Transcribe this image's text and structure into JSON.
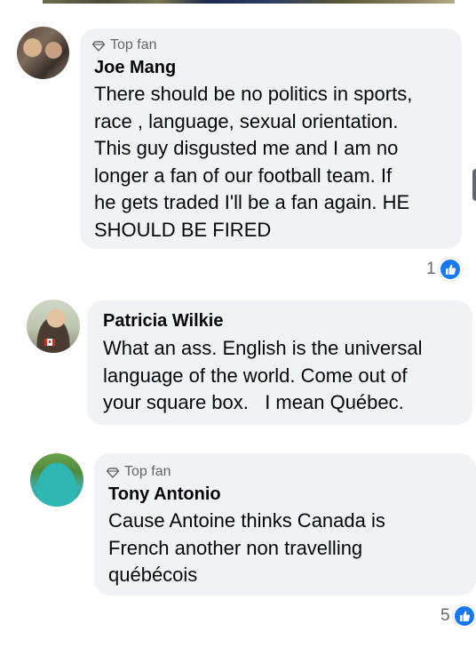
{
  "colors": {
    "bubble": "#f0f2f5",
    "text": "#050505",
    "secondary": "#65676b",
    "like": "#1877f2"
  },
  "comments": [
    {
      "badge": "Top fan",
      "badge_icon": "diamond-icon",
      "name": "Joe Mang",
      "lines": [
        "There should be no politics in sports,",
        "race , language, sexual orientation.",
        "This guy disgusted me and I am no",
        "longer a fan of our football team. If",
        "he gets traded I'll be a fan again. HE",
        "SHOULD BE FIRED"
      ],
      "reactions": {
        "count": "1",
        "icon": "like-icon"
      }
    },
    {
      "name": "Patricia Wilkie",
      "lines": [
        "What an ass. English is the universal",
        "language of the world. Come out of",
        "your square box.   I mean Québec."
      ]
    },
    {
      "badge": "Top fan",
      "badge_icon": "diamond-icon",
      "name": "Tony Antonio",
      "lines": [
        "Cause Antoine thinks Canada is",
        "French another non travelling",
        "québécois"
      ],
      "reactions": {
        "count": "5",
        "icon": "like-icon"
      }
    }
  ]
}
